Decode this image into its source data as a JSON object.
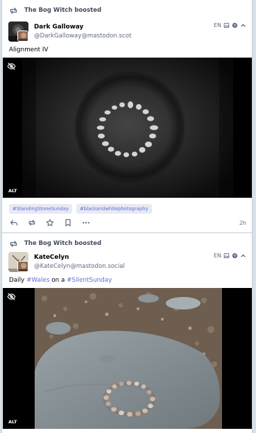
{
  "posts": [
    {
      "boosted_by": "The Bog Witch boosted",
      "display_name": "Dark Galloway",
      "acct": "@DarkGalloway@mastodon.scot",
      "lang": "EN",
      "text": "Alignment IV",
      "media_badge": "ALT",
      "hashtags": [
        "#StandingStoneSunday",
        "#blackandwhitephotography"
      ],
      "time": "2h"
    },
    {
      "boosted_by": "The Bog Witch boosted",
      "display_name": "KateCelyn",
      "acct": "@KateCelyn@mastodon.social",
      "lang": "EN",
      "text_parts": [
        "Daily ",
        "#Wales",
        " on a ",
        "#SilentSunday"
      ],
      "media_badge": "ALT"
    }
  ],
  "icons": {
    "boost": "retweet-icon",
    "visibility": "eye-slash-icon",
    "reply": "reply-icon",
    "favourite": "star-icon",
    "bookmark": "bookmark-icon",
    "more": "ellipsis-icon",
    "image": "image-icon",
    "globe": "globe-icon",
    "collapse": "chevron-up-icon"
  },
  "colors": {
    "accent": "#5b6fd6",
    "secondary_text": "#606984",
    "background": "#d9e1e8",
    "card": "#ffffff"
  }
}
